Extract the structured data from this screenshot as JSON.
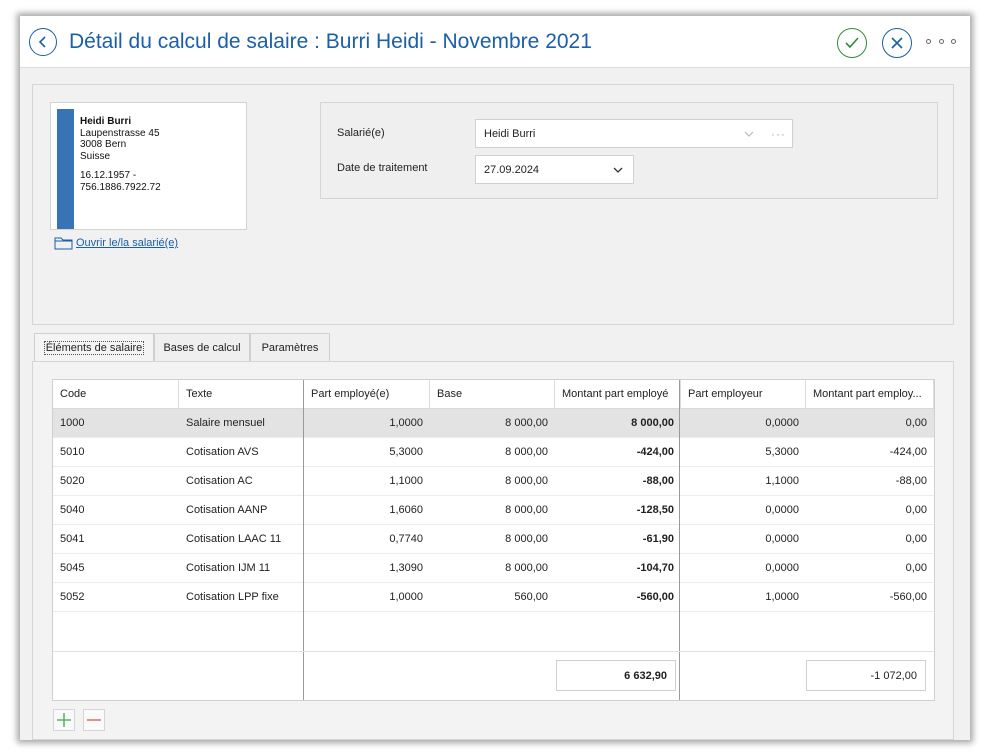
{
  "window": {
    "title": "Détail du calcul de salaire : Burri Heidi - Novembre 2021"
  },
  "employee_card": {
    "name": "Heidi Burri",
    "street": "Laupenstrasse 45",
    "city": "3008 Bern",
    "country": "Suisse",
    "birthdate": "16.12.1957 -",
    "ssn": "756.1886.7922.72",
    "open_link": "Ouvrir le/la salarié(e)"
  },
  "form": {
    "employee_label": "Salarié(e)",
    "employee_value": "Heidi Burri",
    "date_label": "Date de traitement",
    "date_value": "27.09.2024"
  },
  "tabs": [
    {
      "label": "Éléments de salaire",
      "active": true
    },
    {
      "label": "Bases de calcul",
      "active": false
    },
    {
      "label": "Paramètres",
      "active": false
    }
  ],
  "table": {
    "columns": [
      "Code",
      "Texte",
      "Part employé(e)",
      "Base",
      "Montant part employé",
      "Part employeur",
      "Montant part employ..."
    ],
    "rows": [
      [
        "1000",
        "Salaire mensuel",
        "1,0000",
        "8 000,00",
        "8 000,00",
        "0,0000",
        "0,00"
      ],
      [
        "5010",
        "Cotisation AVS",
        "5,3000",
        "8 000,00",
        "-424,00",
        "5,3000",
        "-424,00"
      ],
      [
        "5020",
        "Cotisation AC",
        "1,1000",
        "8 000,00",
        "-88,00",
        "1,1000",
        "-88,00"
      ],
      [
        "5040",
        "Cotisation AANP",
        "1,6060",
        "8 000,00",
        "-128,50",
        "0,0000",
        "0,00"
      ],
      [
        "5041",
        "Cotisation LAAC 11",
        "0,7740",
        "8 000,00",
        "-61,90",
        "0,0000",
        "0,00"
      ],
      [
        "5045",
        "Cotisation IJM 11",
        "1,3090",
        "8 000,00",
        "-104,70",
        "0,0000",
        "0,00"
      ],
      [
        "5052",
        "Cotisation LPP fixe",
        "1,0000",
        "560,00",
        "-560,00",
        "1,0000",
        "-560,00"
      ]
    ],
    "total_employee": "6 632,90",
    "total_employer": "-1 072,00"
  },
  "colors": {
    "accent": "#1a5fa8",
    "ok": "#2e8b3a",
    "add": "#3aa84a",
    "remove": "#d9534f",
    "card_bar": "#3873b5"
  },
  "icons": [
    "back-icon",
    "check-icon",
    "close-icon",
    "more-icon",
    "folder-icon",
    "chevron-down-icon",
    "plus-icon",
    "minus-icon"
  ]
}
